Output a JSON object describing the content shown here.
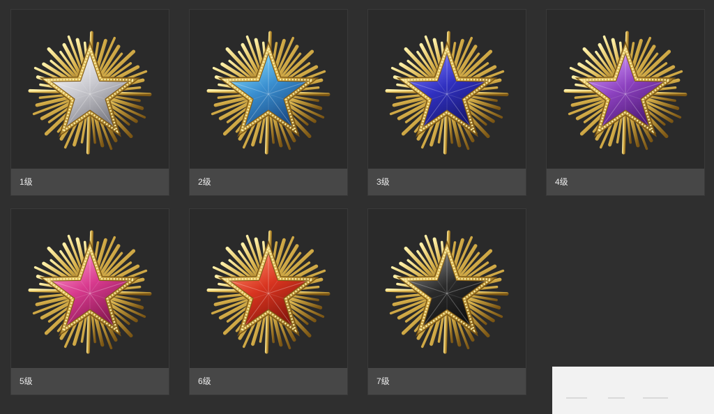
{
  "medals": [
    {
      "label": "1级",
      "star_color": "#c9c9cf",
      "star_light": "#ffffff",
      "star_dark": "#6e6e76"
    },
    {
      "label": "2级",
      "star_color": "#3a8fd0",
      "star_light": "#8be0ff",
      "star_dark": "#143f78"
    },
    {
      "label": "3级",
      "star_color": "#3030c0",
      "star_light": "#7b7bff",
      "star_dark": "#141462"
    },
    {
      "label": "4级",
      "star_color": "#8d42c0",
      "star_light": "#d7a0ff",
      "star_dark": "#45136a"
    },
    {
      "label": "5级",
      "star_color": "#d83a8e",
      "star_light": "#ff9fd0",
      "star_dark": "#7a1248"
    },
    {
      "label": "6级",
      "star_color": "#d83420",
      "star_light": "#ff8e6c",
      "star_dark": "#7a1208"
    },
    {
      "label": "7级",
      "star_color": "#2b2b2b",
      "star_light": "#8a8a8a",
      "star_dark": "#0b0b0b"
    }
  ],
  "colors": {
    "gold": "#d7b04a",
    "gold_light": "#fff0a8",
    "gold_dark": "#7a5514"
  }
}
